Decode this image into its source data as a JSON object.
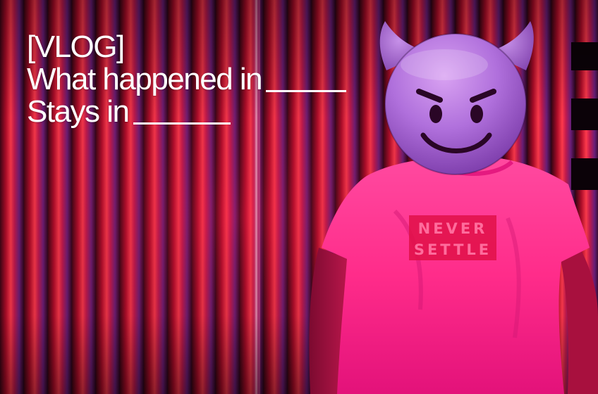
{
  "title": {
    "tag": "[VLOG]",
    "line1": "What happened in",
    "line2": "Stays in"
  },
  "shirt": {
    "word1": "NEVER",
    "word2": "SETTLE"
  },
  "emoji": {
    "name": "smiling-face-with-horns"
  },
  "colors": {
    "curtain_red": "#e0102a",
    "curtain_purple": "#7a2a8c",
    "shirt_pink": "#ff2f8c",
    "skin": "#b0144e",
    "emoji_purple": "#b06ad8",
    "text": "#ffffff"
  }
}
